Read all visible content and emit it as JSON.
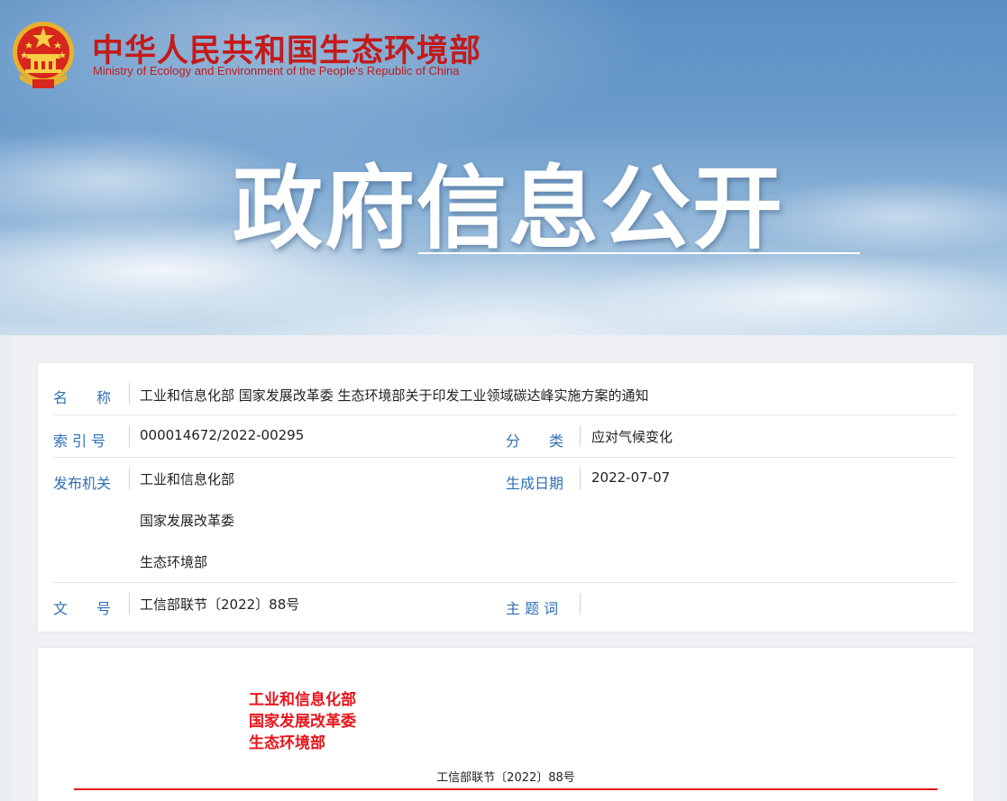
{
  "header": {
    "site_name_cn": "中华人民共和国生态环境部",
    "site_name_en": "Ministry of Ecology and Environment of the People's Republic of China",
    "emblem_icon": "national-emblem-icon",
    "banner_title": "政府信息公开"
  },
  "meta": {
    "name_label": "名　　称",
    "name_value": "工业和信息化部 国家发展改革委 生态环境部关于印发工业领域碳达峰实施方案的通知",
    "index_label": "索 引 号",
    "index_value": "000014672/2022-00295",
    "category_label": "分　　类",
    "category_value": "应对气候变化",
    "issuer_label": "发布机关",
    "issuers": [
      "工业和信息化部",
      "国家发展改革委",
      "生态环境部"
    ],
    "date_label": "生成日期",
    "date_value": "2022-07-07",
    "docno_label": "文　　号",
    "docno_value": "工信部联节〔2022〕88号",
    "keywords_label": "主 题 词",
    "keywords_value": ""
  },
  "document": {
    "issuers": [
      "工业和信息化部",
      "国家发展改革委",
      "生态环境部"
    ],
    "doc_number": "工信部联节〔2022〕88号"
  },
  "colors": {
    "brand_red": "#c41a1a",
    "label_blue": "#2f6fb5",
    "doc_red": "#e8141b"
  }
}
